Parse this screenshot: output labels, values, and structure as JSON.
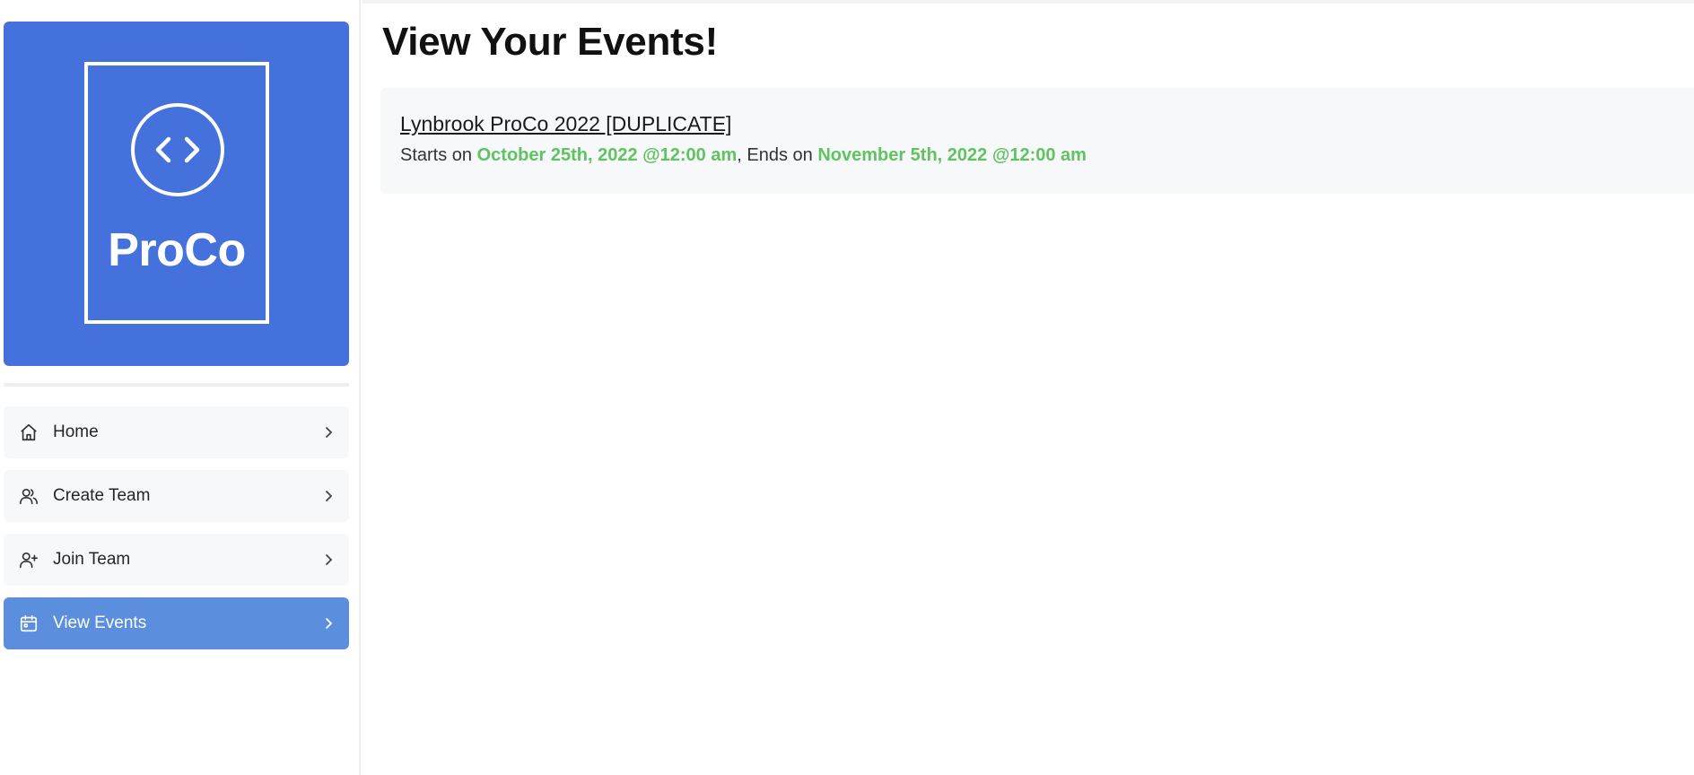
{
  "brand": {
    "name": "ProCo",
    "color": "#4571dd",
    "icon": "code-brackets-icon"
  },
  "sidebar": {
    "items": [
      {
        "label": "Home",
        "icon": "home-icon",
        "active": false
      },
      {
        "label": "Create Team",
        "icon": "users-icon",
        "active": false
      },
      {
        "label": "Join Team",
        "icon": "user-plus-icon",
        "active": false
      },
      {
        "label": "View Events",
        "icon": "calendar-icon",
        "active": true
      }
    ],
    "active_color": "#5b8fdd"
  },
  "main": {
    "title": "View Your Events!",
    "events": [
      {
        "name": "Lynbrook ProCo 2022 [DUPLICATE]",
        "starts_prefix": "Starts on ",
        "start": "October 25th, 2022 @12:00 am",
        "separator": ", Ends on ",
        "end": "November 5th, 2022 @12:00 am",
        "date_color": "#5fc35f"
      }
    ]
  }
}
